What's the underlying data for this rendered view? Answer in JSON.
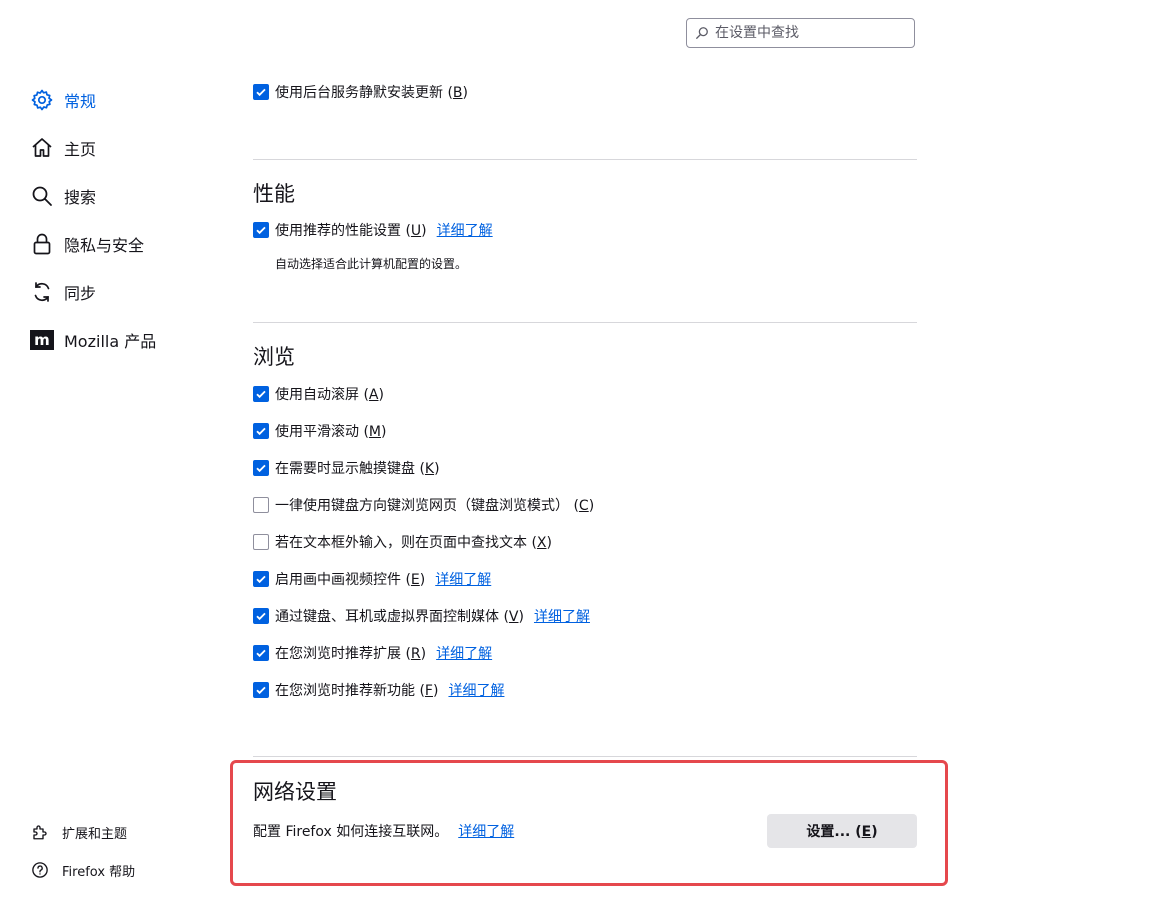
{
  "search": {
    "placeholder": "在设置中查找"
  },
  "sidebar": {
    "items": [
      {
        "label": "常规",
        "icon": "gear-icon",
        "active": true
      },
      {
        "label": "主页",
        "icon": "home-icon"
      },
      {
        "label": "搜索",
        "icon": "search-icon"
      },
      {
        "label": "隐私与安全",
        "icon": "lock-icon"
      },
      {
        "label": "同步",
        "icon": "sync-icon"
      },
      {
        "label": "Mozilla 产品",
        "icon": "mozilla-icon"
      }
    ],
    "footer": [
      {
        "label": "扩展和主题",
        "icon": "puzzle-icon"
      },
      {
        "label": "Firefox 帮助",
        "icon": "help-icon"
      }
    ]
  },
  "updates": {
    "background_service": {
      "text": "使用后台服务静默安装更新 (",
      "key": "B",
      "end": ")",
      "checked": true
    }
  },
  "performance": {
    "title": "性能",
    "recommended": {
      "text": "使用推荐的性能设置 (",
      "key": "U",
      "end": ")",
      "checked": true,
      "link": "详细了解"
    },
    "description": "自动选择适合此计算机配置的设置。"
  },
  "browsing": {
    "title": "浏览",
    "options": [
      {
        "text": "使用自动滚屏 (",
        "key": "A",
        "end": ")",
        "checked": true
      },
      {
        "text": "使用平滑滚动 (",
        "key": "M",
        "end": ")",
        "checked": true
      },
      {
        "text": "在需要时显示触摸键盘 (",
        "key": "K",
        "end": ")",
        "checked": true
      },
      {
        "text": "一律使用键盘方向键浏览网页（键盘浏览模式） (",
        "key": "C",
        "end": ")",
        "checked": false
      },
      {
        "text": "若在文本框外输入，则在页面中查找文本 (",
        "key": "X",
        "end": ")",
        "checked": false
      },
      {
        "text": "启用画中画视频控件 (",
        "key": "E",
        "end": ")",
        "checked": true,
        "link": "详细了解"
      },
      {
        "text": "通过键盘、耳机或虚拟界面控制媒体 (",
        "key": "V",
        "end": ")",
        "checked": true,
        "link": "详细了解"
      },
      {
        "text": "在您浏览时推荐扩展 (",
        "key": "R",
        "end": ")",
        "checked": true,
        "link": "详细了解"
      },
      {
        "text": "在您浏览时推荐新功能 (",
        "key": "F",
        "end": ")",
        "checked": true,
        "link": "详细了解"
      }
    ]
  },
  "network": {
    "title": "网络设置",
    "description": "配置 Firefox 如何连接互联网。",
    "link": "详细了解",
    "button_text": "设置... (",
    "button_key": "E",
    "button_end": ")"
  },
  "colors": {
    "accent": "#0061e0",
    "highlight": "#e5484d"
  }
}
